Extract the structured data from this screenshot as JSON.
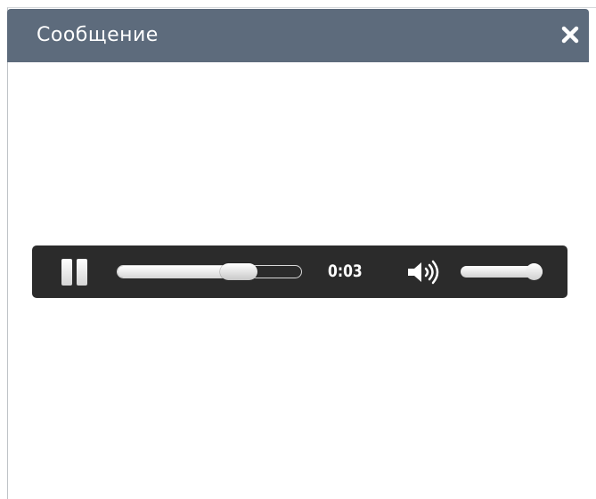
{
  "dialog": {
    "title": "Сообщение",
    "close_icon": "close-icon"
  },
  "player": {
    "state": "playing",
    "pause_icon": "pause-icon",
    "progress": 0.66,
    "time": "0:03",
    "volume_icon": "speaker-icon",
    "volume": 1.0
  },
  "colors": {
    "titlebar": "#5d6b7c",
    "player_background": "#2b2b2b",
    "control_foreground": "#ffffff"
  }
}
